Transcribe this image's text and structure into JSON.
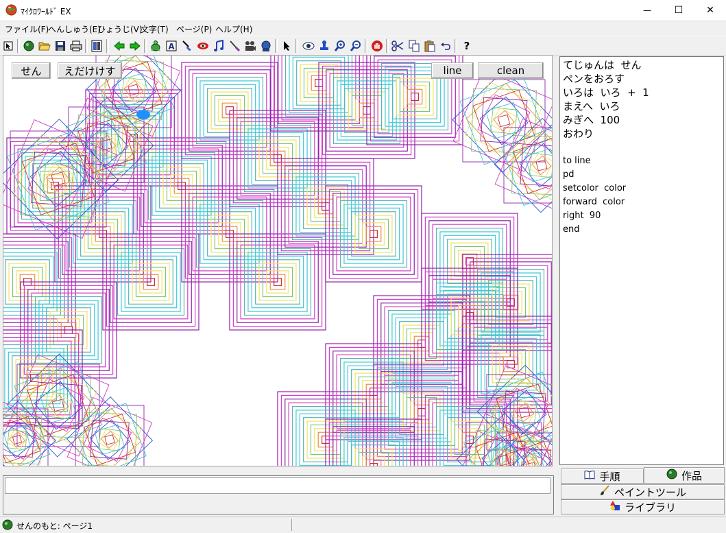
{
  "window": {
    "title": "ﾏｲｸﾛﾜｰﾙﾄﾞ EX",
    "controls": {
      "minimize": "—",
      "maximize": "☐",
      "close": "✕"
    }
  },
  "menu": [
    "ファイル(F)",
    "へんしゅう(E)",
    "ひょうじ(V)",
    "文字(T)",
    "ページ(P)",
    "ヘルプ(H)"
  ],
  "toolbar": {
    "icons": [
      "pointer-icon",
      "planet-icon",
      "open-folder-icon",
      "save-disk-icon",
      "print-icon",
      "page-icon",
      "back-arrow-icon",
      "forward-arrow-icon",
      "turtle-icon",
      "text-icon",
      "paint-icon",
      "eye-mask-icon",
      "music-note-icon",
      "brush-icon",
      "film-icon",
      "sound-icon",
      "select-arrow-icon",
      "view-icon",
      "stamp-icon",
      "zoom-in-icon",
      "zoom-out-icon",
      "stop-hand-icon",
      "cut-icon",
      "copy-icon",
      "paste-icon",
      "undo-icon",
      "help-icon"
    ],
    "help_label": "?"
  },
  "canvas": {
    "buttons": {
      "sen": "せん",
      "edakesu": "えだけけす",
      "line": "line",
      "clean": "clean"
    },
    "colors": {
      "purple": "#8e24aa",
      "magenta": "#d63cc8",
      "cyan": "#3cc8d6",
      "teal": "#5ab4b4",
      "yellow": "#f0e060",
      "green": "#78c878",
      "orange": "#e89040",
      "red": "#d03030",
      "blue": "#3050d0"
    }
  },
  "code": {
    "lines": [
      "てじゅんは  せん",
      "ペンをおろす",
      "いろは  いろ  +  1",
      "まえへ  いろ",
      "みぎへ  100",
      "おわり",
      "",
      "to line",
      "pd",
      "setcolor  color",
      "forward  color",
      "right  90",
      "end"
    ]
  },
  "tabs": {
    "procedure": "手順",
    "works": "作品",
    "paint_tool": "ペイントツール",
    "library": "ライブラリ"
  },
  "command": {
    "value": ""
  },
  "status": {
    "text": "せんのもと: ページ1"
  }
}
